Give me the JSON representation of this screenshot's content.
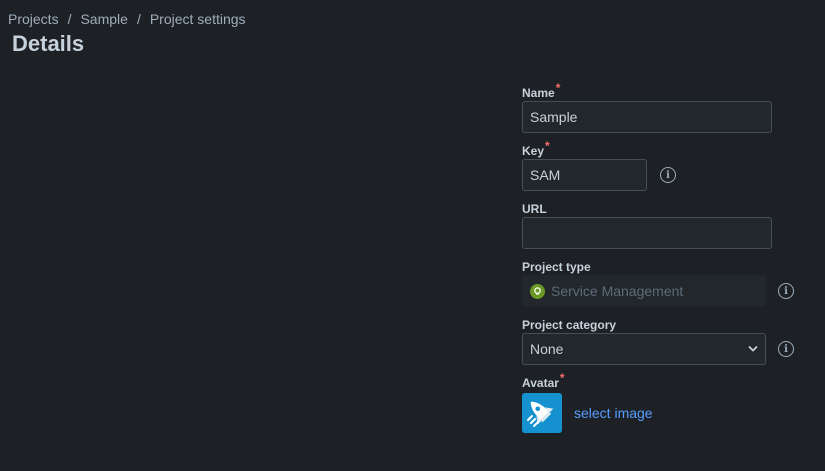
{
  "breadcrumb": {
    "items": [
      "Projects",
      "Sample",
      "Project settings"
    ],
    "separator": "/"
  },
  "page": {
    "title": "Details"
  },
  "form": {
    "name": {
      "label": "Name",
      "required_mark": "*",
      "value": "Sample"
    },
    "key": {
      "label": "Key",
      "required_mark": "*",
      "value": "SAM",
      "info_icon": "info-icon"
    },
    "url": {
      "label": "URL",
      "value": ""
    },
    "project_type": {
      "label": "Project type",
      "value": "Service Management",
      "icon": "service-management-icon",
      "info_icon": "info-icon"
    },
    "project_category": {
      "label": "Project category",
      "value": "None",
      "info_icon": "info-icon"
    },
    "avatar": {
      "label": "Avatar",
      "required_mark": "*",
      "link_text": "select image",
      "icon": "rocket-avatar-icon"
    }
  },
  "colors": {
    "background": "#1d2125",
    "input_bg": "#22272b",
    "input_border": "#454f59",
    "required": "#f87168",
    "link": "#579dff",
    "service_management": "#6a9a23"
  }
}
